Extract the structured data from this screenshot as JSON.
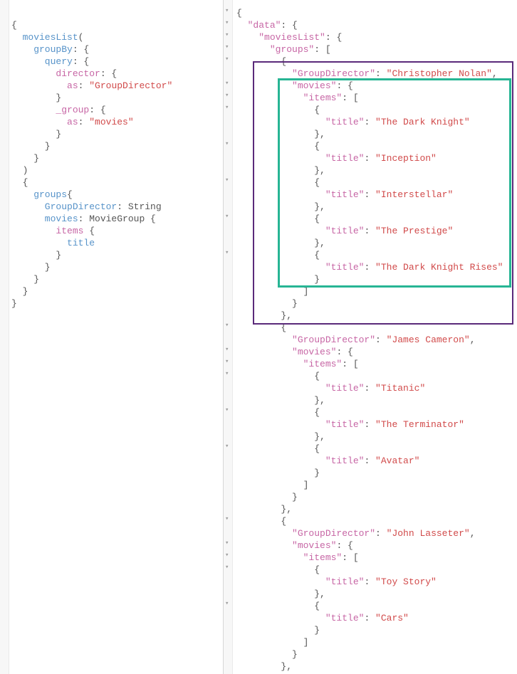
{
  "left": {
    "l1": "{",
    "l2a": "  moviesList",
    "l2b": "(",
    "l3a": "    groupBy",
    "l3b": ": {",
    "l4a": "      query",
    "l4b": ": {",
    "l5a": "        director",
    "l5b": ": {",
    "l6a": "          as",
    "l6b": ": ",
    "l6c": "\"GroupDirector\"",
    "l7": "        }",
    "l8a": "        _group",
    "l8b": ": {",
    "l9a": "          as",
    "l9b": ": ",
    "l9c": "\"movies\"",
    "l10": "        }",
    "l11": "      }",
    "l12": "    }",
    "l13": "  )",
    "l14": "  {",
    "l15a": "    groups",
    "l15b": "{",
    "l16a": "      GroupDirector",
    "l16b": ": String",
    "l17a": "      movies",
    "l17b": ": MovieGroup {",
    "l18a": "        items",
    "l18b": " {",
    "l19": "          title",
    "l20": "        }",
    "l21": "      }",
    "l22": "    }",
    "l23": "  }",
    "l24": "}"
  },
  "right": {
    "key_data": "\"data\"",
    "key_moviesList": "\"moviesList\"",
    "key_groups": "\"groups\"",
    "key_GroupDirector": "\"GroupDirector\"",
    "key_movies": "\"movies\"",
    "key_items": "\"items\"",
    "key_title": "\"title\"",
    "directors": {
      "d1": "\"Christopher Nolan\"",
      "d2": "\"James Cameron\"",
      "d3": "\"John Lasseter\""
    },
    "titles": {
      "t1": "\"The Dark Knight\"",
      "t2": "\"Inception\"",
      "t3": "\"Interstellar\"",
      "t4": "\"The Prestige\"",
      "t5": "\"The Dark Knight Rises\"",
      "t6": "\"Titanic\"",
      "t7": "\"The Terminator\"",
      "t8": "\"Avatar\"",
      "t9": "\"Toy Story\"",
      "t10": "\"Cars\""
    }
  },
  "chart_data": {
    "type": "table",
    "groups": [
      {
        "GroupDirector": "Christopher Nolan",
        "movies": [
          "The Dark Knight",
          "Inception",
          "Interstellar",
          "The Prestige",
          "The Dark Knight Rises"
        ]
      },
      {
        "GroupDirector": "James Cameron",
        "movies": [
          "Titanic",
          "The Terminator",
          "Avatar"
        ]
      },
      {
        "GroupDirector": "John Lasseter",
        "movies": [
          "Toy Story",
          "Cars"
        ]
      }
    ]
  }
}
